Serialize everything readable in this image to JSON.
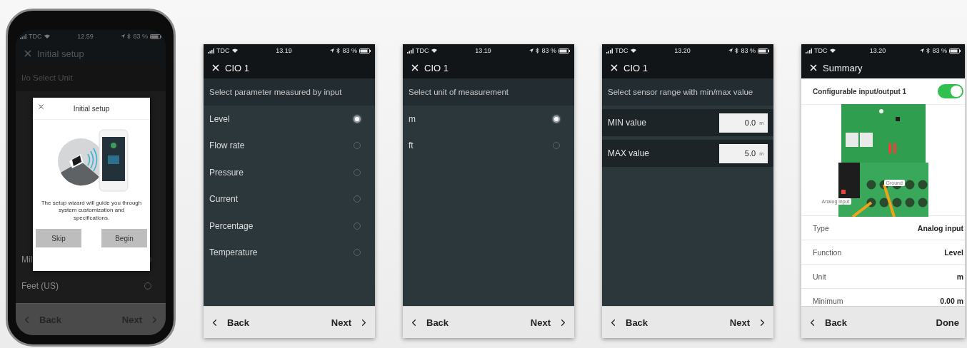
{
  "screens": [
    {
      "kind": "options",
      "status": {
        "carrier": "TDC",
        "time": "12.59",
        "battery": "83 %"
      },
      "title": "Initial setup",
      "prompt": "I/o Select Unit",
      "options": [
        {
          "label": "Mil",
          "selected": false
        },
        {
          "label": "Feet (US)",
          "selected": false
        }
      ],
      "footer": {
        "back": "Back",
        "next": "Next",
        "next_arrow": true
      },
      "dialog": {
        "title": "Initial setup",
        "text": "The setup wizard will guide you through system customization and specifications.",
        "buttons": [
          "Skip",
          "Begin"
        ]
      }
    },
    {
      "kind": "options",
      "status": {
        "carrier": "TDC",
        "time": "13.19",
        "battery": "83 %"
      },
      "title": "CIO 1",
      "prompt": "Select parameter measured by input",
      "options": [
        {
          "label": "Level",
          "selected": true
        },
        {
          "label": "Flow rate",
          "selected": false
        },
        {
          "label": "Pressure",
          "selected": false
        },
        {
          "label": "Current",
          "selected": false
        },
        {
          "label": "Percentage",
          "selected": false
        },
        {
          "label": "Temperature",
          "selected": false
        }
      ],
      "footer": {
        "back": "Back",
        "next": "Next",
        "next_arrow": true
      }
    },
    {
      "kind": "options",
      "status": {
        "carrier": "TDC",
        "time": "13.19",
        "battery": "83 %"
      },
      "title": "CIO 1",
      "prompt": "Select unit of measurement",
      "options": [
        {
          "label": "m",
          "selected": true
        },
        {
          "label": "ft",
          "selected": false
        }
      ],
      "footer": {
        "back": "Back",
        "next": "Next",
        "next_arrow": true
      }
    },
    {
      "kind": "range",
      "status": {
        "carrier": "TDC",
        "time": "13.20",
        "battery": "83 %"
      },
      "title": "CIO 1",
      "prompt": "Select sensor range with min/max value",
      "fields": [
        {
          "label": "MIN value",
          "value": "0.0",
          "unit": "m"
        },
        {
          "label": "MAX value",
          "value": "5.0",
          "unit": "m"
        }
      ],
      "footer": {
        "back": "Back",
        "next": "Next",
        "next_arrow": true
      }
    },
    {
      "kind": "summary",
      "status": {
        "carrier": "TDC",
        "time": "13.20",
        "battery": "83 %"
      },
      "title": "Summary",
      "toggle": {
        "label": "Configurable input/output 1",
        "on": true
      },
      "board": {
        "labels": [
          "Ground",
          "Analog input"
        ]
      },
      "rows": [
        {
          "label": "Type",
          "value": "Analog input"
        },
        {
          "label": "Function",
          "value": "Level"
        },
        {
          "label": "Unit",
          "value": "m"
        },
        {
          "label": "Minimum",
          "value": "0.00 m"
        }
      ],
      "footer": {
        "back": "Back",
        "next": "Done",
        "next_arrow": false
      }
    }
  ]
}
